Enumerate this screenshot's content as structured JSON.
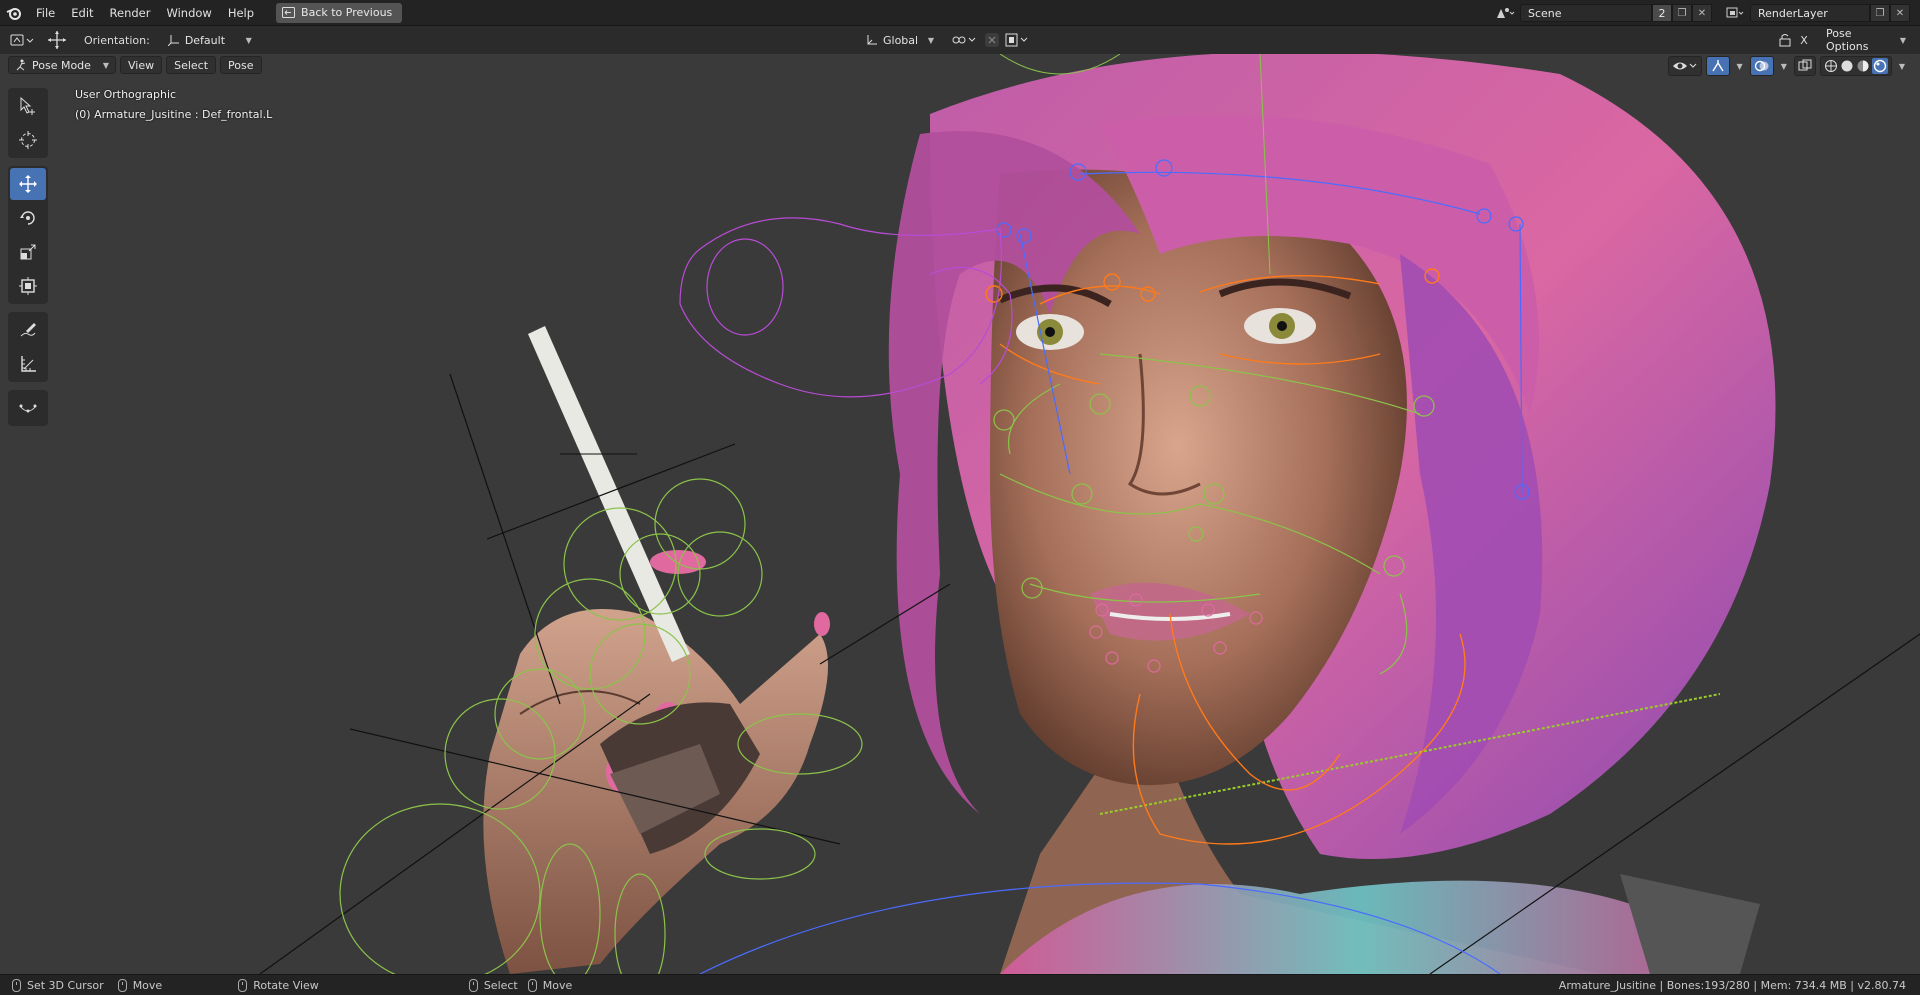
{
  "app": {
    "menu": [
      "File",
      "Edit",
      "Render",
      "Window",
      "Help"
    ],
    "back_button": "Back to Previous"
  },
  "scene": {
    "name": "Scene",
    "count": "2",
    "render_layer": "RenderLayer"
  },
  "header": {
    "orientation_label": "Orientation:",
    "orientation_value": "Default",
    "transform_space": "Global",
    "pose_options": "Pose Options"
  },
  "viewport": {
    "mode": "Pose Mode",
    "menus": [
      "View",
      "Select",
      "Pose"
    ],
    "view_name": "User Orthographic",
    "active_info": "(0) Armature_Jusitine : Def_frontal.L"
  },
  "toolbar": {
    "tools": [
      "select-tool",
      "cursor-tool",
      "move-tool",
      "rotate-tool",
      "scale-tool",
      "transform-tool",
      "annotate-tool",
      "measure-tool",
      "relax-tool"
    ],
    "active": "move-tool",
    "accent": "#4772b3"
  },
  "statusbar": {
    "items": [
      {
        "label": "Set 3D Cursor"
      },
      {
        "label": "Move"
      },
      {
        "label": "Rotate View"
      },
      {
        "label": "Select"
      },
      {
        "label": "Move"
      }
    ],
    "info": "Armature_Jusitine | Bones:193/280 | Mem: 734.4 MB | v2.80.74"
  },
  "colors": {
    "bone_green": "#8bc34a",
    "bone_orange": "#ff7a1a",
    "bone_blue": "#4a6cff",
    "bone_purple": "#b84cd6",
    "hair_pink": "#e0559a"
  }
}
